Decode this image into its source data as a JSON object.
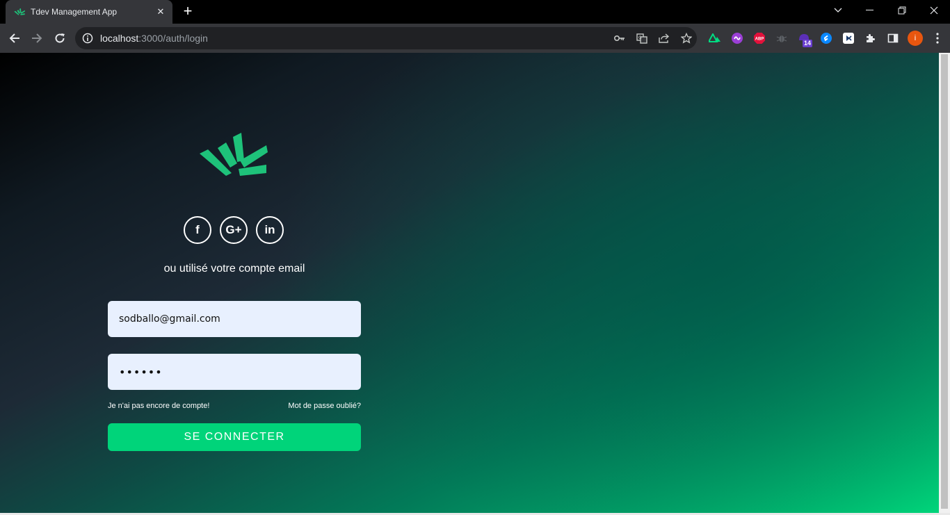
{
  "browser": {
    "tab_title": "Tdev Management App",
    "tab_close": "✕",
    "new_tab": "+",
    "url_host": "localhost",
    "url_path": ":3000/auth/login",
    "extension_badge": "14",
    "profile_initial": "i"
  },
  "login": {
    "social_facebook": "f",
    "social_google": "G+",
    "social_linkedin": "in",
    "alt_text": "ou utilisé votre compte email",
    "email_value": "sodballo@gmail.com",
    "password_value": "••••••",
    "no_account_link": "Je n'ai pas encore de compte!",
    "forgot_password_link": "Mot de passe oublié?",
    "submit_label": "SE CONNECTER"
  },
  "colors": {
    "accent": "#00d47a",
    "logo": "#1ec27a",
    "field_bg": "#e8f0fe"
  }
}
